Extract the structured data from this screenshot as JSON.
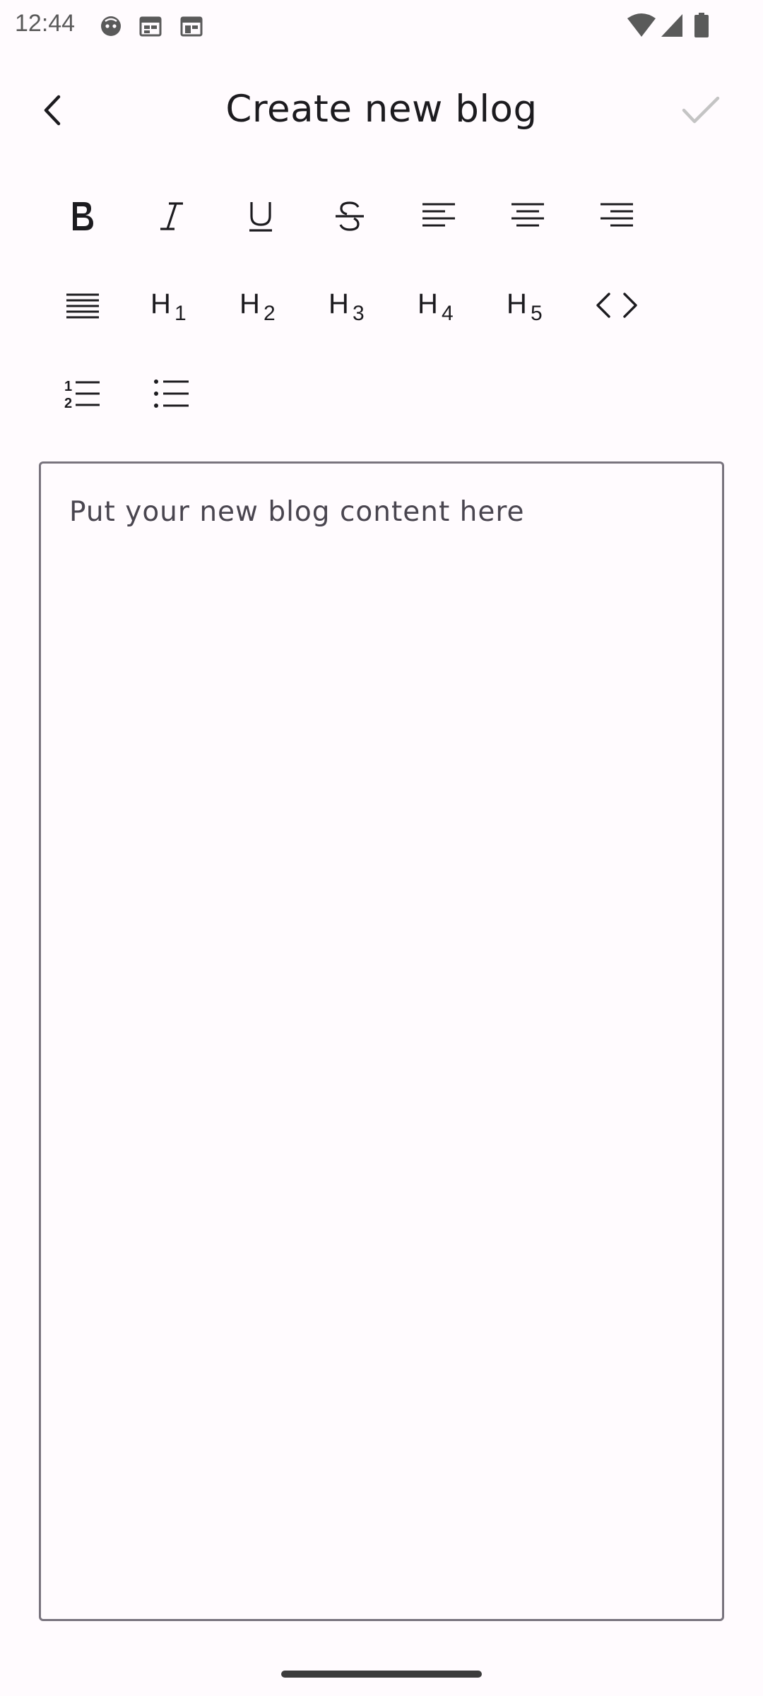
{
  "status_bar": {
    "time": "12:44",
    "notification_icons": [
      "face-icon",
      "calendar-icon",
      "calendar-icon"
    ],
    "right_icons": [
      "wifi-icon",
      "signal-icon",
      "battery-icon"
    ]
  },
  "app_bar": {
    "title": "Create new blog",
    "back_icon": "chevron-left-icon",
    "done_icon": "check-icon"
  },
  "toolbar": {
    "rows": [
      [
        "bold",
        "italic",
        "underline",
        "strikethrough",
        "align-left",
        "align-center",
        "align-right"
      ],
      [
        "justify",
        "heading-1",
        "heading-2",
        "heading-3",
        "heading-4",
        "heading-5",
        "code"
      ],
      [
        "numbered-list",
        "bulleted-list"
      ]
    ],
    "heading_labels": {
      "h1": "H",
      "h1_sub": "1",
      "h2": "H",
      "h2_sub": "2",
      "h3": "H",
      "h3_sub": "3",
      "h4": "H",
      "h4_sub": "4",
      "h5": "H",
      "h5_sub": "5"
    },
    "list_labels": {
      "num_1": "1",
      "num_2": "2"
    }
  },
  "editor": {
    "placeholder": "Put your new blog content here",
    "value": ""
  },
  "colors": {
    "background": "#FFFBFE",
    "text": "#1C1B1F",
    "placeholder": "#49454F",
    "outline": "#79747E",
    "disabled_check": "#C4C4C4"
  }
}
